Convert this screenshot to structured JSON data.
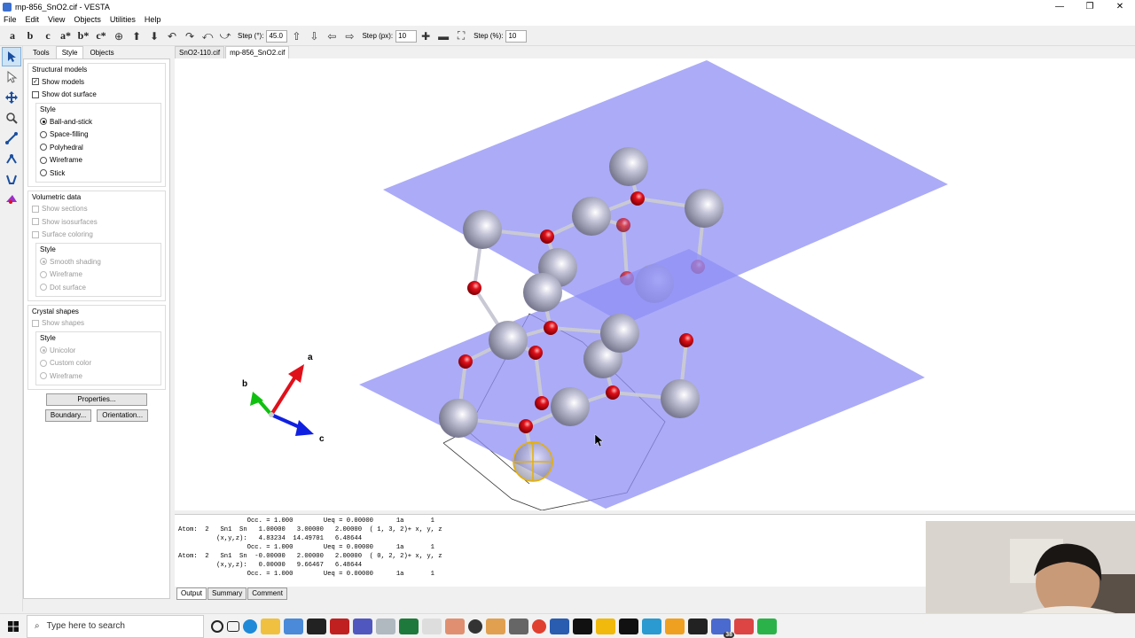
{
  "window": {
    "title": "mp-856_SnO2.cif - VESTA",
    "controls": [
      "—",
      "❐",
      "✕"
    ]
  },
  "menu": [
    "File",
    "Edit",
    "View",
    "Objects",
    "Utilities",
    "Help"
  ],
  "toolbar": {
    "axis_buttons": [
      "a",
      "b",
      "c",
      "a*",
      "b*",
      "c*"
    ],
    "step_deg_label": "Step (°):",
    "step_deg_value": "45.0",
    "step_px_label": "Step (px):",
    "step_px_value": "10",
    "step_pct_label": "Step (%):",
    "step_pct_value": "10"
  },
  "panel": {
    "tabs": [
      "Tools",
      "Style",
      "Objects"
    ],
    "active_tab": "Style",
    "structural": {
      "title": "Structural models",
      "show_models": "Show models",
      "show_dot_surface": "Show dot surface",
      "style_title": "Style",
      "styles": [
        "Ball-and-stick",
        "Space-filling",
        "Polyhedral",
        "Wireframe",
        "Stick"
      ]
    },
    "volumetric": {
      "title": "Volumetric data",
      "show_sections": "Show sections",
      "show_isosurfaces": "Show isosurfaces",
      "surface_coloring": "Surface coloring",
      "style_title": "Style",
      "styles": [
        "Smooth shading",
        "Wireframe",
        "Dot surface"
      ]
    },
    "crystal": {
      "title": "Crystal shapes",
      "show_shapes": "Show shapes",
      "style_title": "Style",
      "styles": [
        "Unicolor",
        "Custom color",
        "Wireframe"
      ]
    },
    "properties_btn": "Properties...",
    "boundary_btn": "Boundary...",
    "orientation_btn": "Orientation..."
  },
  "doc_tabs": [
    "SnO2-110.cif",
    "mp-856_SnO2.cif"
  ],
  "axes": {
    "a": "a",
    "b": "b",
    "c": "c"
  },
  "output_lines": [
    "                  Occ. = 1.000        Ueq = 0.00000      1a       1",
    "Atom:  2   Sn1  Sn   1.00000   3.00000   2.00000  ( 1, 3, 2)+ x, y, z",
    "          (x,y,z):   4.83234  14.49701   6.48644",
    "                  Occ. = 1.000        Ueq = 0.00000      1a       1",
    "Atom:  2   Sn1  Sn  -0.00000   2.00000   2.00000  ( 0, 2, 2)+ x, y, z",
    "          (x,y,z):   0.00000   9.66467   6.48644",
    "                  Occ. = 1.000        Ueq = 0.00000      1a       1"
  ],
  "output_tabs": [
    "Output",
    "Summary",
    "Comment"
  ],
  "taskbar": {
    "search_placeholder": "Type here to search",
    "badge": "38"
  },
  "colors": {
    "plane": "#8f8ff5",
    "oxygen": "#e0101a",
    "tin": "#b8b8cc"
  }
}
